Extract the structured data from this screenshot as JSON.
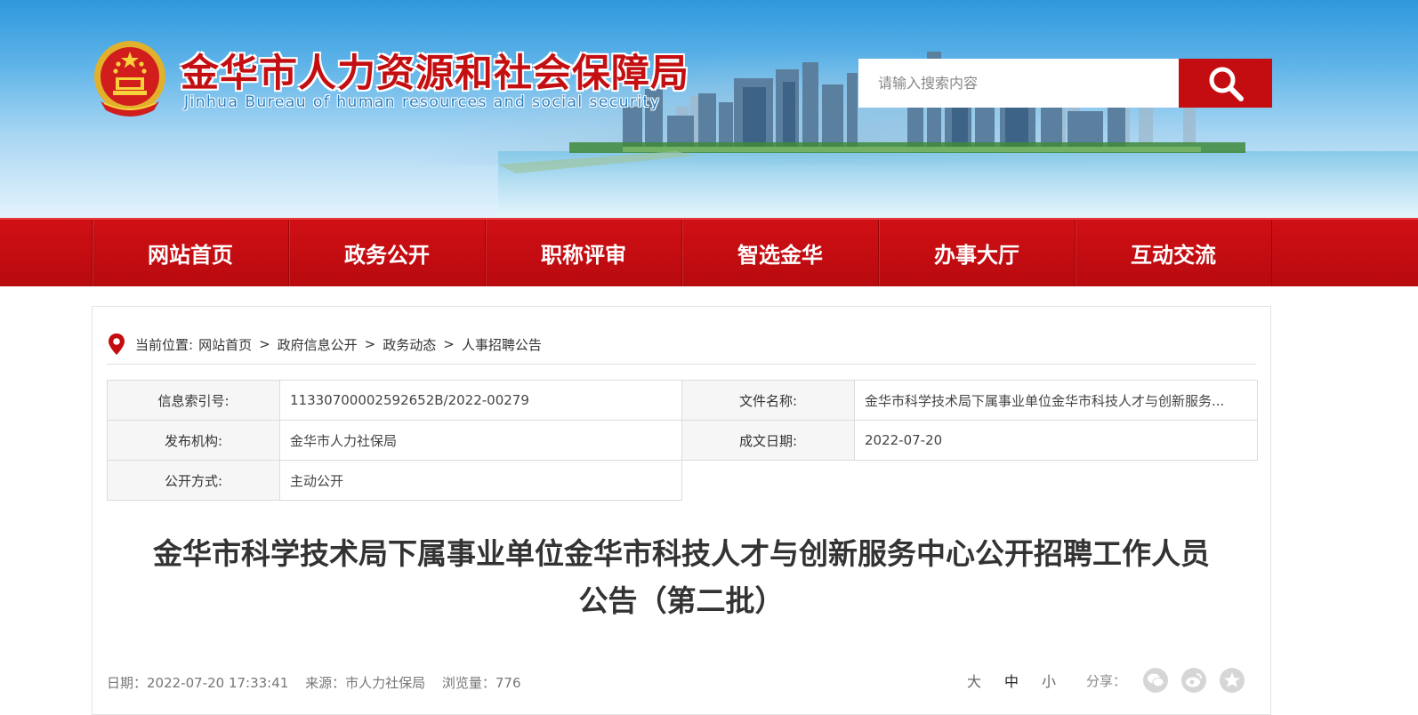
{
  "header": {
    "title": "金华市人力资源和社会保障局",
    "subtitle": "Jinhua Bureau of human resources and social security",
    "search_placeholder": "请输入搜索内容"
  },
  "nav": {
    "items": [
      "网站首页",
      "政务公开",
      "职称评审",
      "智选金华",
      "办事大厅",
      "互动交流"
    ]
  },
  "breadcrumb": {
    "prefix": "当前位置:",
    "items": [
      "网站首页",
      "政府信息公开",
      "政务动态",
      "人事招聘公告"
    ],
    "separator": ">"
  },
  "meta_table": {
    "index_label": "信息索引号:",
    "index_value": "11330700002592652B/2022-00279",
    "filename_label": "文件名称:",
    "filename_value": "金华市科学技术局下属事业单位金华市科技人才与创新服务...",
    "publisher_label": "发布机构:",
    "publisher_value": "金华市人力社保局",
    "date_label": "成文日期:",
    "date_value": "2022-07-20",
    "mode_label": "公开方式:",
    "mode_value": "主动公开"
  },
  "article": {
    "title_line1": "金华市科学技术局下属事业单位金华市科技人才与创新服务中心公开招聘工作人员",
    "title_line2": "公告（第二批）",
    "date": "日期：2022-07-20 17:33:41",
    "source": "来源：市人力社保局",
    "views": "浏览量：776",
    "font_large": "大",
    "font_medium": "中",
    "font_small": "小",
    "share_label": "分享："
  },
  "colors": {
    "brand_red": "#c40d11",
    "banner_blue": "#2f98dd"
  },
  "icons": [
    "national-emblem-icon",
    "search-icon",
    "location-pin-icon",
    "wechat-icon",
    "weibo-icon",
    "qzone-icon"
  ]
}
